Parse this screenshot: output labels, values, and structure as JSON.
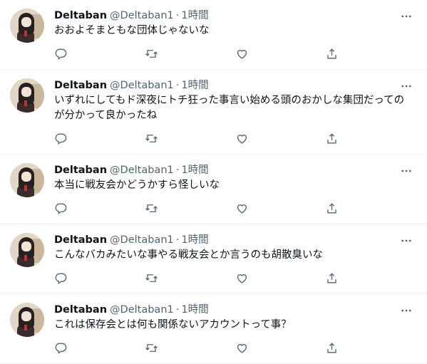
{
  "tweets": [
    {
      "name": "Deltaban",
      "handle": "@Deltaban1",
      "dot": "·",
      "time": "1時間",
      "text": "おおよそまともな団体じゃないな"
    },
    {
      "name": "Deltaban",
      "handle": "@Deltaban1",
      "dot": "·",
      "time": "1時間",
      "text": "いずれにしてもド深夜にトチ狂った事言い始める頭のおかしな集団だってのが分かって良かったね"
    },
    {
      "name": "Deltaban",
      "handle": "@Deltaban1",
      "dot": "·",
      "time": "1時間",
      "text": "本当に戦友会かどうかすら怪しいな"
    },
    {
      "name": "Deltaban",
      "handle": "@Deltaban1",
      "dot": "·",
      "time": "1時間",
      "text": "こんなバカみたいな事やる戦友会とか言うのも胡散臭いな"
    },
    {
      "name": "Deltaban",
      "handle": "@Deltaban1",
      "dot": "·",
      "time": "1時間",
      "text": "これは保存会とは何も関係ないアカウントって事？"
    }
  ],
  "icons": {
    "more": "more-horizontal-icon",
    "reply": "reply-icon",
    "retweet": "retweet-icon",
    "like": "heart-icon",
    "share": "share-icon"
  },
  "colors": {
    "text": "#0f1419",
    "secondary": "#536471",
    "divider": "#eff3f4"
  }
}
